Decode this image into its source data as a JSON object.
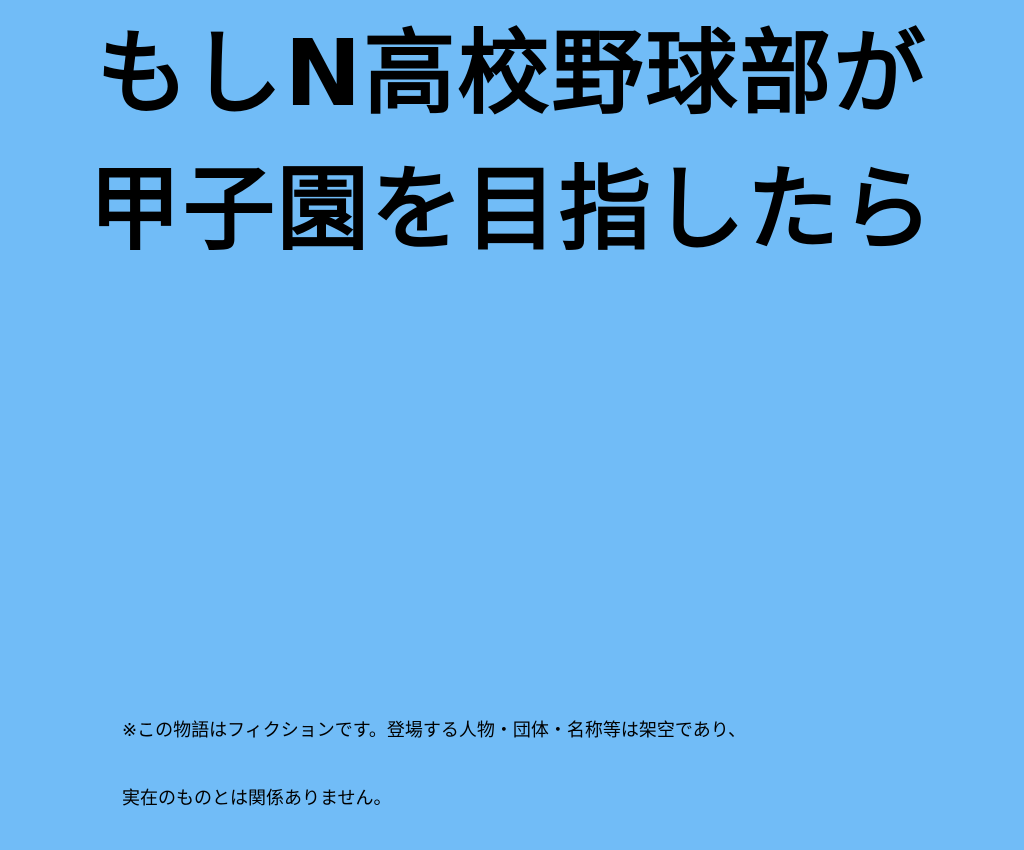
{
  "slide": {
    "background_color": "#71bcf7",
    "title_line1": "もしN高校野球部が",
    "title_line2": "甲子園を目指したら",
    "disclaimer_line1": "※この物語はフィクションです。登場する人物・団体・名称等は架空であり、",
    "disclaimer_line2": "実在のものとは関係ありません。"
  }
}
